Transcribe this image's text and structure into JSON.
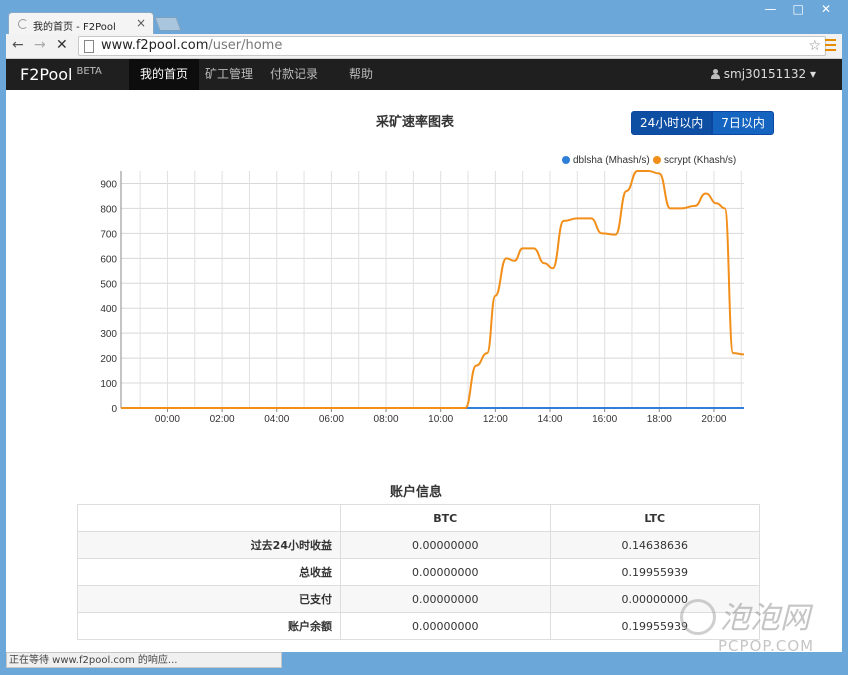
{
  "browser": {
    "tab_title": "我的首页 - F2Pool",
    "tab_close": "×",
    "window_controls": [
      "—",
      "□",
      "✕"
    ],
    "nav_back": "←",
    "nav_forward": "→",
    "nav_stop": "✕",
    "url_host": "www.f2pool.com",
    "url_path": "/user/home",
    "status_text": "正在等待 www.f2pool.com 的响应..."
  },
  "navbar": {
    "brand": "F2Pool",
    "brand_badge": "BETA",
    "items": [
      {
        "label": "我的首页",
        "active": true
      },
      {
        "label": "矿工管理",
        "active": false
      },
      {
        "label": "付款记录",
        "active": false
      },
      {
        "label": "帮助",
        "active": false
      }
    ],
    "username": "smj30151132"
  },
  "hashrate": {
    "title": "采矿速率图表",
    "range_buttons": [
      {
        "label": "24小时以内",
        "active": true
      },
      {
        "label": "7日以内",
        "active": false
      }
    ]
  },
  "chart_data": {
    "type": "line",
    "title": "",
    "xlabel": "",
    "ylabel": "",
    "x_ticks": [
      "00:00",
      "02:00",
      "04:00",
      "06:00",
      "08:00",
      "10:00",
      "12:00",
      "14:00",
      "16:00",
      "18:00",
      "20:00"
    ],
    "y_ticks": [
      0,
      100,
      200,
      300,
      400,
      500,
      600,
      700,
      800,
      900
    ],
    "xlim_hours": [
      -1.7,
      21.1
    ],
    "ylim": [
      0,
      950
    ],
    "grid": true,
    "legend_position": "top-right",
    "series": [
      {
        "name": "dblsha (Mhash/s)",
        "color": "#2f7ed8",
        "x_hours": [
          -1.7,
          21.1
        ],
        "values": [
          0,
          0
        ]
      },
      {
        "name": "scrypt (Khash/s)",
        "color": "#f28f1a",
        "x_hours": [
          -1.7,
          10.9,
          11.3,
          11.7,
          12.0,
          12.4,
          12.7,
          13.0,
          13.4,
          13.8,
          14.1,
          14.5,
          15.0,
          15.5,
          15.9,
          16.4,
          16.8,
          17.2,
          17.6,
          18.0,
          18.4,
          18.8,
          19.3,
          19.7,
          20.1,
          20.4,
          20.7,
          21.1
        ],
        "values": [
          0,
          0,
          170,
          220,
          450,
          600,
          590,
          640,
          640,
          580,
          560,
          750,
          760,
          760,
          700,
          695,
          870,
          950,
          950,
          940,
          800,
          800,
          810,
          860,
          820,
          800,
          220,
          215
        ]
      }
    ]
  },
  "account": {
    "title": "账户信息",
    "columns": [
      "",
      "BTC",
      "LTC"
    ],
    "rows": [
      {
        "label": "过去24小时收益",
        "btc": "0.00000000",
        "ltc": "0.14638636"
      },
      {
        "label": "总收益",
        "btc": "0.00000000",
        "ltc": "0.19955939"
      },
      {
        "label": "已支付",
        "btc": "0.00000000",
        "ltc": "0.00000000"
      },
      {
        "label": "账户余额",
        "btc": "0.00000000",
        "ltc": "0.19955939"
      }
    ]
  },
  "watermark": {
    "text": "泡泡网",
    "sub": "PCPOP.COM"
  }
}
